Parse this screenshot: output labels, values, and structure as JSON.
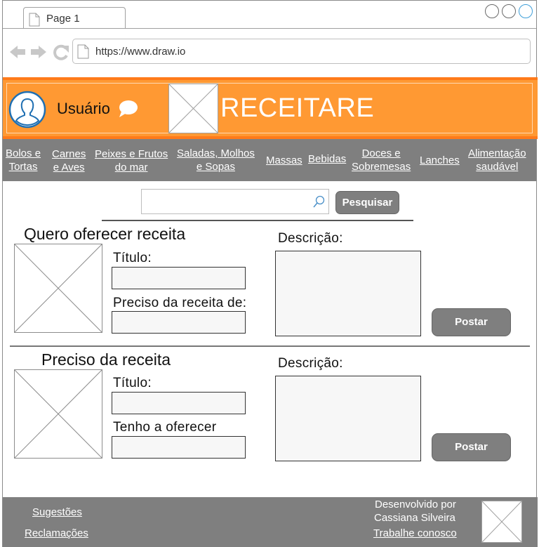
{
  "browser": {
    "tab_label": "Page 1",
    "url": "https://www.draw.io"
  },
  "header": {
    "user_label": "Usuário",
    "brand": "RECEITARE",
    "colors": {
      "header": "#ff9933",
      "header_border": "#ff7a1a",
      "menu": "#7f7f7f"
    }
  },
  "menu": {
    "items": [
      {
        "line1": "Bolos e",
        "line2": "Tortas"
      },
      {
        "line1": "Carnes",
        "line2": "e Aves"
      },
      {
        "line1": "Peixes e Frutos",
        "line2": "do mar"
      },
      {
        "line1": "Saladas, Molhos",
        "line2": "e Sopas"
      },
      {
        "line1": "Massas",
        "line2": ""
      },
      {
        "line1": "Bebidas",
        "line2": ""
      },
      {
        "line1": "Doces e",
        "line2": "Sobremesas"
      },
      {
        "line1": "Lanches",
        "line2": ""
      },
      {
        "line1": "Alimentação",
        "line2": "saudável"
      }
    ]
  },
  "search": {
    "value": "",
    "button_label": "Pesquisar"
  },
  "offer_section": {
    "title": "Quero oferecer receita",
    "title_label": "Título:",
    "second_label": "Preciso da receita de:",
    "description_label": "Descrição:",
    "post_label": "Postar"
  },
  "need_section": {
    "title": "Preciso da receita",
    "title_label": "Título:",
    "second_label": "Tenho a oferecer",
    "description_label": "Descrição:",
    "post_label": "Postar"
  },
  "footer": {
    "suggestions": "Sugestões",
    "complaints": "Reclamações",
    "developed_by": "Desenvolvido por",
    "developer": "Cassiana Silveira",
    "careers": "Trabalhe conosco"
  }
}
